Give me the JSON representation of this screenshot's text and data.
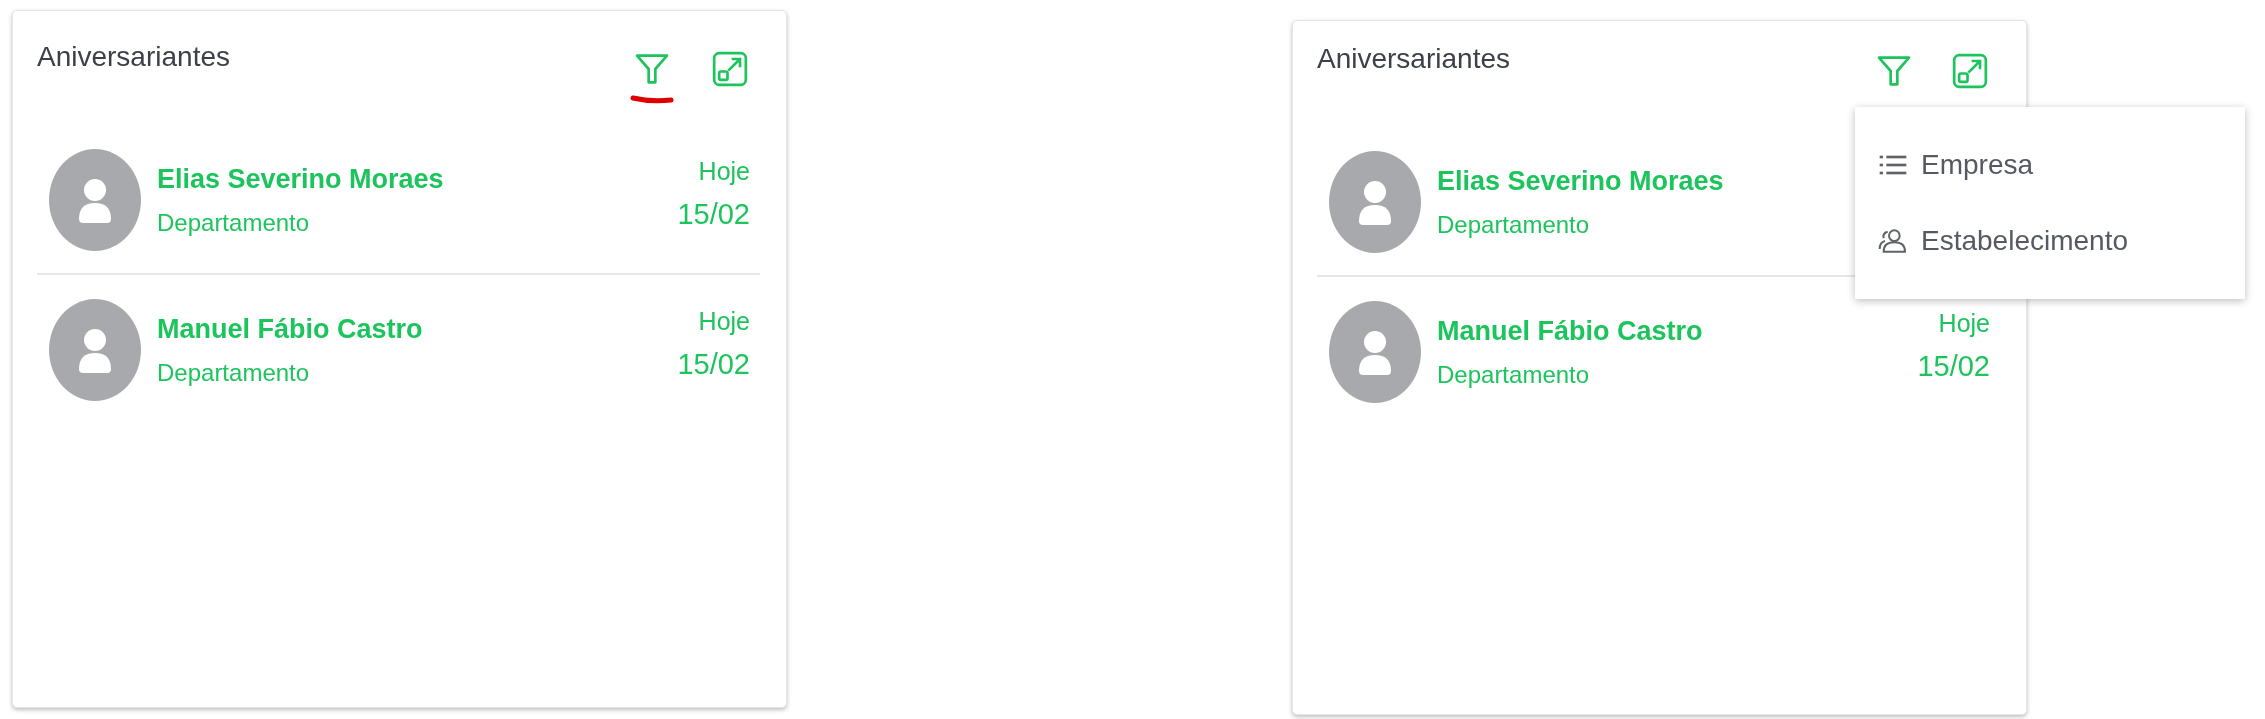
{
  "panels": [
    {
      "title": "Aniversariantes",
      "filter_marked": true,
      "menu_open": false,
      "people": [
        {
          "name": "Elias Severino Moraes",
          "department": "Departamento",
          "day": "Hoje",
          "date": "15/02"
        },
        {
          "name": "Manuel Fábio Castro",
          "department": "Departamento",
          "day": "Hoje",
          "date": "15/02"
        }
      ]
    },
    {
      "title": "Aniversariantes",
      "filter_marked": false,
      "menu_open": true,
      "people": [
        {
          "name": "Elias Severino Moraes",
          "department": "Departamento"
        },
        {
          "name": "Manuel Fábio Castro",
          "department": "Departamento",
          "day": "Hoje",
          "date": "15/02"
        }
      ],
      "menu": [
        {
          "kind": "list",
          "label": "Empresa"
        },
        {
          "kind": "people",
          "label": "Estabelecimento"
        }
      ]
    }
  ]
}
